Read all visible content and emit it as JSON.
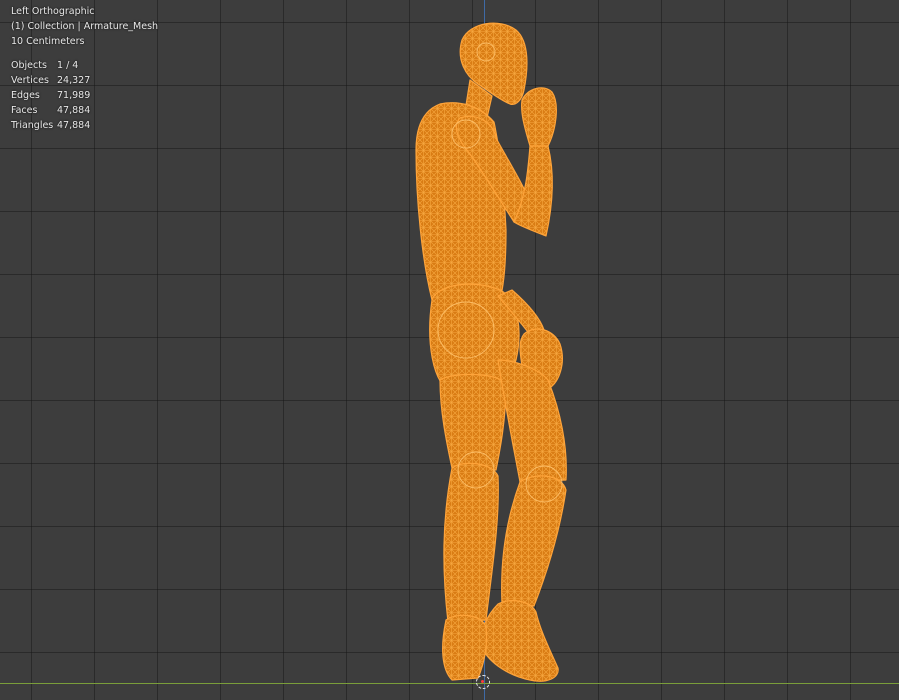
{
  "viewport": {
    "view_name": "Left Orthographic",
    "collection_line": "(1) Collection | Armature_Mesh",
    "scale": "10 Centimeters"
  },
  "stats": [
    {
      "label": "Objects",
      "value": "1 / 4"
    },
    {
      "label": "Vertices",
      "value": "24,327"
    },
    {
      "label": "Edges",
      "value": "71,989"
    },
    {
      "label": "Faces",
      "value": "47,884"
    },
    {
      "label": "Triangles",
      "value": "47,884"
    }
  ],
  "colors": {
    "mesh_fill": "#e8871c",
    "mesh_wire": "#ffb347",
    "grid_bg": "#3d3d3d",
    "axis_y": "#3f6fb0",
    "axis_x": "#7a9e3a"
  }
}
